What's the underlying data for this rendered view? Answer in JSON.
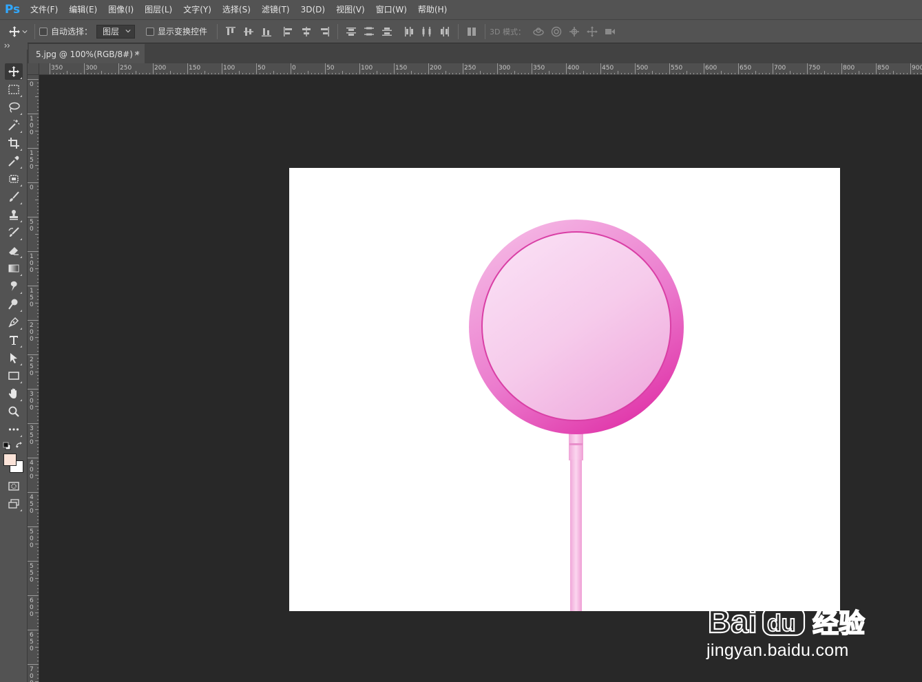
{
  "app": {
    "logo": "Ps"
  },
  "menu": [
    "文件(F)",
    "编辑(E)",
    "图像(I)",
    "图层(L)",
    "文字(Y)",
    "选择(S)",
    "滤镜(T)",
    "3D(D)",
    "视图(V)",
    "窗口(W)",
    "帮助(H)"
  ],
  "options": {
    "auto_select_label": "自动选择：",
    "auto_select_target": "图层",
    "show_transform_label": "显示变换控件",
    "mode_3d_label": "3D 模式："
  },
  "document_tab": {
    "label": "5.jpg @ 100%(RGB/8#) *",
    "close": "×"
  },
  "rulers": {
    "horizontal": [
      "350",
      "300",
      "250",
      "200",
      "150",
      "100",
      "50",
      "0",
      "50",
      "100",
      "150",
      "200",
      "250",
      "300",
      "350",
      "400",
      "450",
      "500",
      "550",
      "600",
      "650",
      "700",
      "750",
      "800",
      "850",
      "900"
    ],
    "vertical": [
      "0",
      "100",
      "150",
      "0",
      "50",
      "100",
      "150",
      "200",
      "250",
      "300",
      "350",
      "400",
      "450",
      "500",
      "550",
      "600",
      "650",
      "700"
    ]
  },
  "colors": {
    "foreground": "#fbe3d8",
    "background": "#ffffff",
    "lollipop_rim": "#e33fb0",
    "lollipop_face": "#f6c6ea",
    "stick": "#f4b6df"
  },
  "watermark": {
    "text": "jingyan.baidu.com",
    "brand": "Bai",
    "brand_suffix": "du",
    "product": "经验"
  }
}
